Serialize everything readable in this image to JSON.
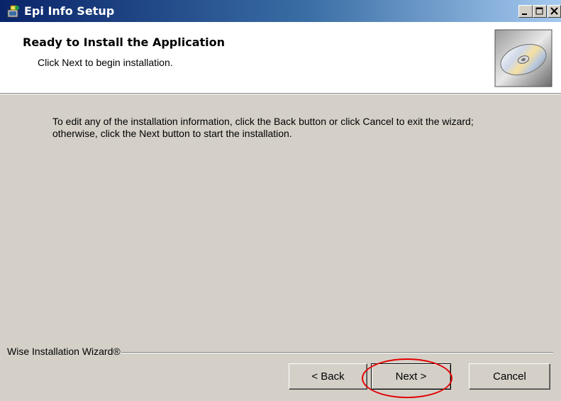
{
  "window": {
    "title": "Epi Info Setup",
    "controls": {
      "minimize": "minimize-icon",
      "maximize": "maximize-icon",
      "close": "close-icon"
    }
  },
  "header": {
    "title": "Ready to Install the Application",
    "subtitle": "Click Next to begin installation.",
    "icon": "cd-disc-icon"
  },
  "body": {
    "text": "To edit any of the installation information, click the Back button or click Cancel to exit the wizard; otherwise, click  the Next button to start the installation."
  },
  "footer": {
    "brand": "Wise Installation Wizard®"
  },
  "buttons": {
    "back": "< Back",
    "next": "Next >",
    "cancel": "Cancel"
  },
  "annotation": {
    "color": "#e00000",
    "shape": "ellipse"
  },
  "colors": {
    "titlebar_start": "#0a246a",
    "face": "#d4d0c8"
  }
}
